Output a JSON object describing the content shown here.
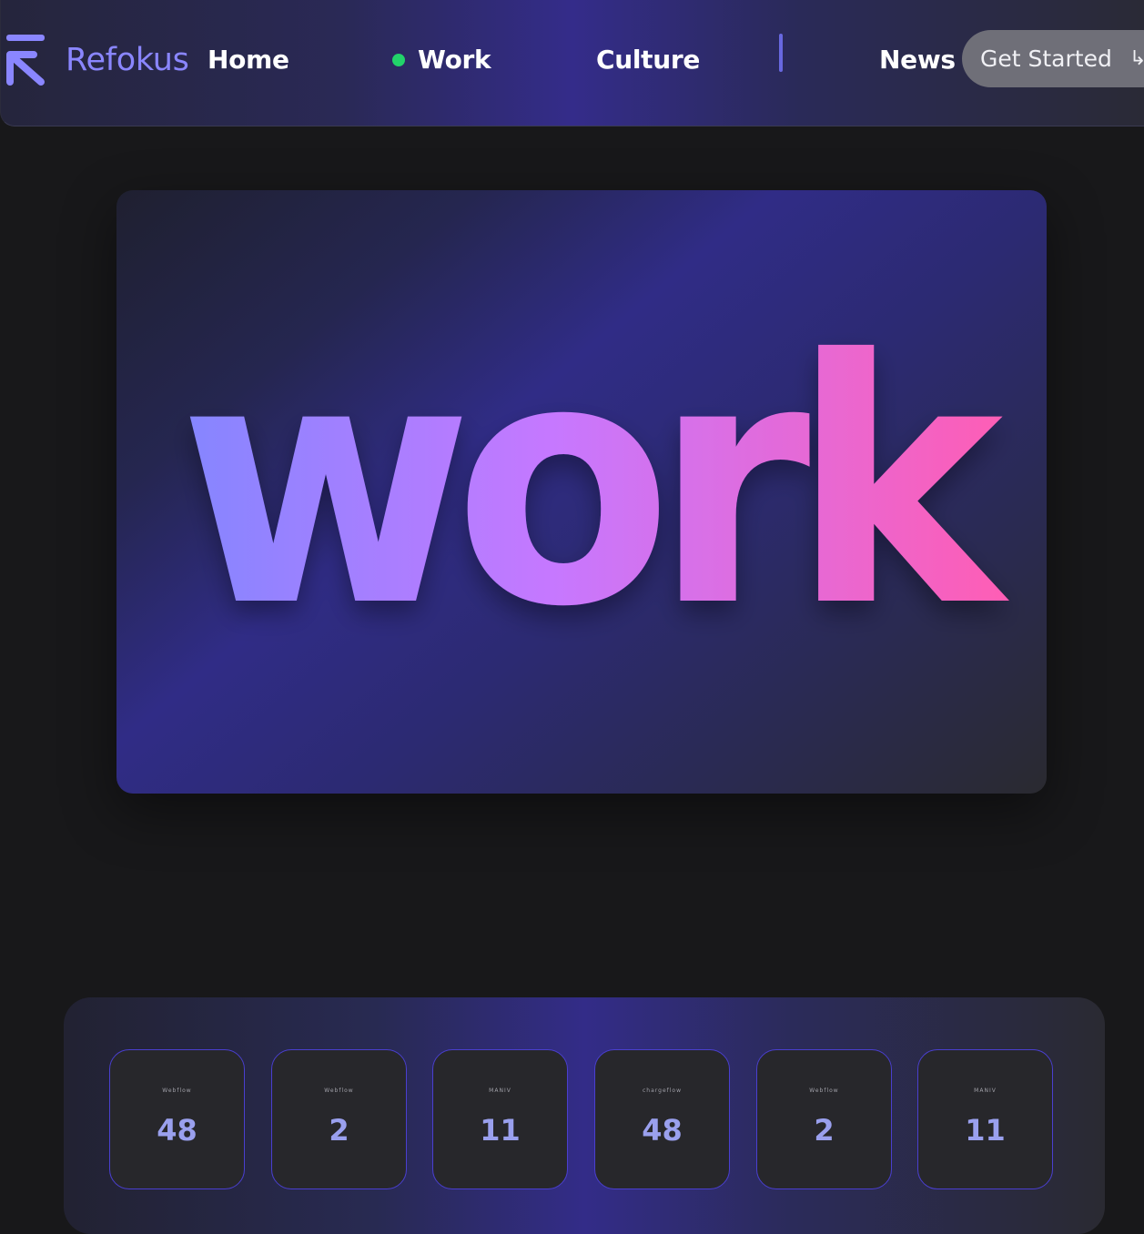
{
  "nav": {
    "brand": "Refokus",
    "links": [
      "Home",
      "Work",
      "Culture",
      "News"
    ],
    "active": "Work",
    "cta_label": "Get Started",
    "cta_icon": "arrow-icon"
  },
  "hero": {
    "word": "work"
  },
  "clients": {
    "cards": [
      {
        "logo": "Webflow",
        "number": "48"
      },
      {
        "logo": "Webflow",
        "number": "2"
      },
      {
        "logo": "MANIV",
        "number": "11"
      },
      {
        "logo": "chargeflow",
        "number": "48"
      },
      {
        "logo": "Webflow",
        "number": "2"
      },
      {
        "logo": "MANIV",
        "number": "11"
      }
    ]
  },
  "colors": {
    "accent": "#8a86ff",
    "active_dot": "#22d36a",
    "card_border": "#4a3fcf",
    "gradient_start": "#8486ff",
    "gradient_mid": "#c678ff",
    "gradient_end": "#ff5db4"
  }
}
